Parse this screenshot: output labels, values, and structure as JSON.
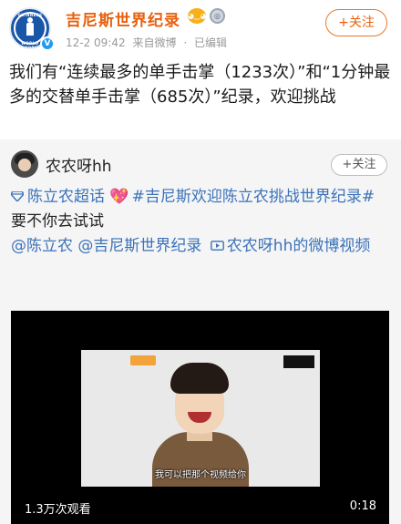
{
  "post": {
    "author": "吉尼斯世界纪录",
    "avatar_text_top": "GUINNESS",
    "avatar_text_bottom": "WORLD RECORDS",
    "timestamp": "12-2 09:42",
    "source": "来自微博",
    "separator": "·",
    "edited": "已编辑",
    "follow_label": "+关注",
    "text": "我们有“连续最多的单手击掌（1233次）”和“1分钟最多的交替单手击掌（685次）”纪录，欢迎挑战"
  },
  "repost": {
    "author": "农农呀hh",
    "follow_label": "+关注",
    "topic1": "陈立农超话",
    "topic2": "#吉尼斯欢迎陈立农挑战世界纪录#",
    "line2": "要不你去试试",
    "mention1": "@陈立农",
    "mention2": "@吉尼斯世界纪录",
    "video_link": "农农呀hh的微博视频"
  },
  "video": {
    "logo": "",
    "tag": "",
    "corner": "",
    "subtitle": "我可以把那个视频给你",
    "views": "1.3万次观看",
    "duration": "0:18"
  },
  "colors": {
    "author_orange": "#e8600e",
    "link_blue": "#3b72b9",
    "repost_bg": "#f5f5f5"
  }
}
